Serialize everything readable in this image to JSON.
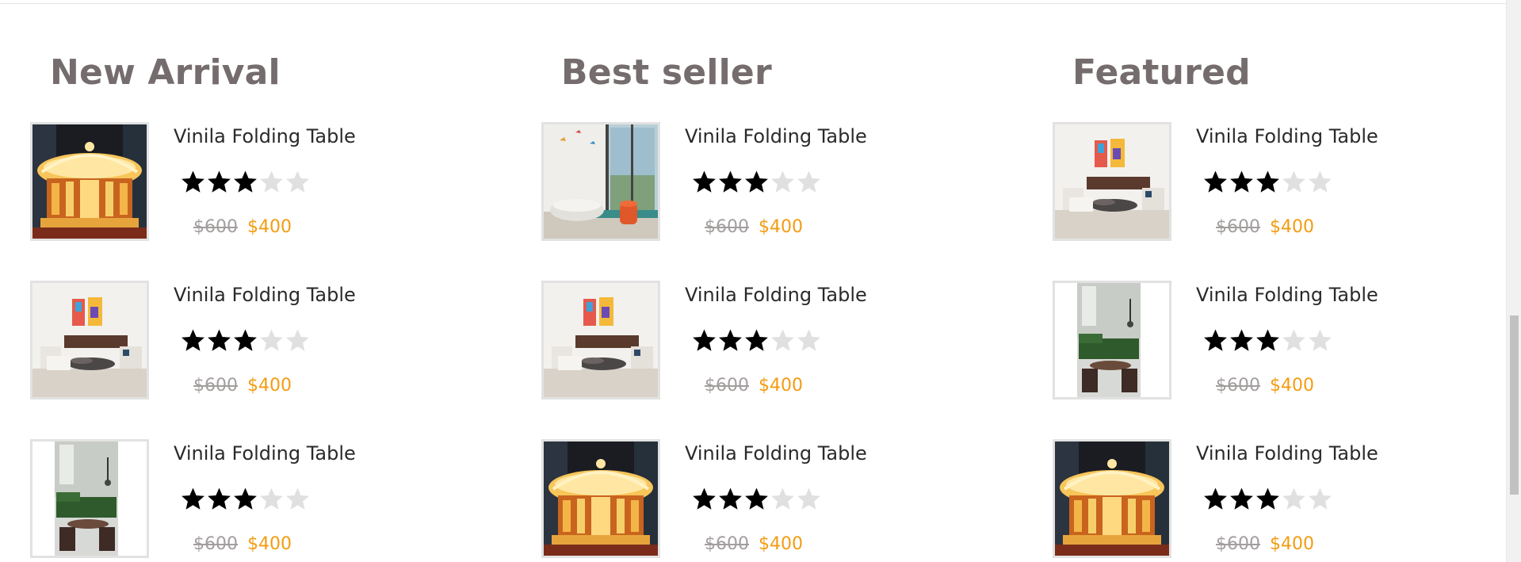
{
  "colors": {
    "title": "#756d6d",
    "new_price": "#f39c12",
    "old_price": "#a39e9e",
    "star_filled": "#000000",
    "star_empty": "#e0e0e0"
  },
  "sections": [
    {
      "title": "New Arrival",
      "products": [
        {
          "name": "Vinila Folding Table",
          "rating": 3,
          "max_rating": 5,
          "old_price": "$600",
          "price": "$400",
          "image": "carousel-image"
        },
        {
          "name": "Vinila Folding Table",
          "rating": 3,
          "max_rating": 5,
          "old_price": "$600",
          "price": "$400",
          "image": "living-room-image"
        },
        {
          "name": "Vinila Folding Table",
          "rating": 3,
          "max_rating": 5,
          "old_price": "$600",
          "price": "$400",
          "image": "green-sofa-image"
        }
      ]
    },
    {
      "title": "Best seller",
      "products": [
        {
          "name": "Vinila Folding Table",
          "rating": 3,
          "max_rating": 5,
          "old_price": "$600",
          "price": "$400",
          "image": "lounge-image"
        },
        {
          "name": "Vinila Folding Table",
          "rating": 3,
          "max_rating": 5,
          "old_price": "$600",
          "price": "$400",
          "image": "living-room-image"
        },
        {
          "name": "Vinila Folding Table",
          "rating": 3,
          "max_rating": 5,
          "old_price": "$600",
          "price": "$400",
          "image": "carousel-image"
        }
      ]
    },
    {
      "title": "Featured",
      "products": [
        {
          "name": "Vinila Folding Table",
          "rating": 3,
          "max_rating": 5,
          "old_price": "$600",
          "price": "$400",
          "image": "living-room-image"
        },
        {
          "name": "Vinila Folding Table",
          "rating": 3,
          "max_rating": 5,
          "old_price": "$600",
          "price": "$400",
          "image": "green-sofa-image"
        },
        {
          "name": "Vinila Folding Table",
          "rating": 3,
          "max_rating": 5,
          "old_price": "$600",
          "price": "$400",
          "image": "carousel-image"
        }
      ]
    }
  ]
}
